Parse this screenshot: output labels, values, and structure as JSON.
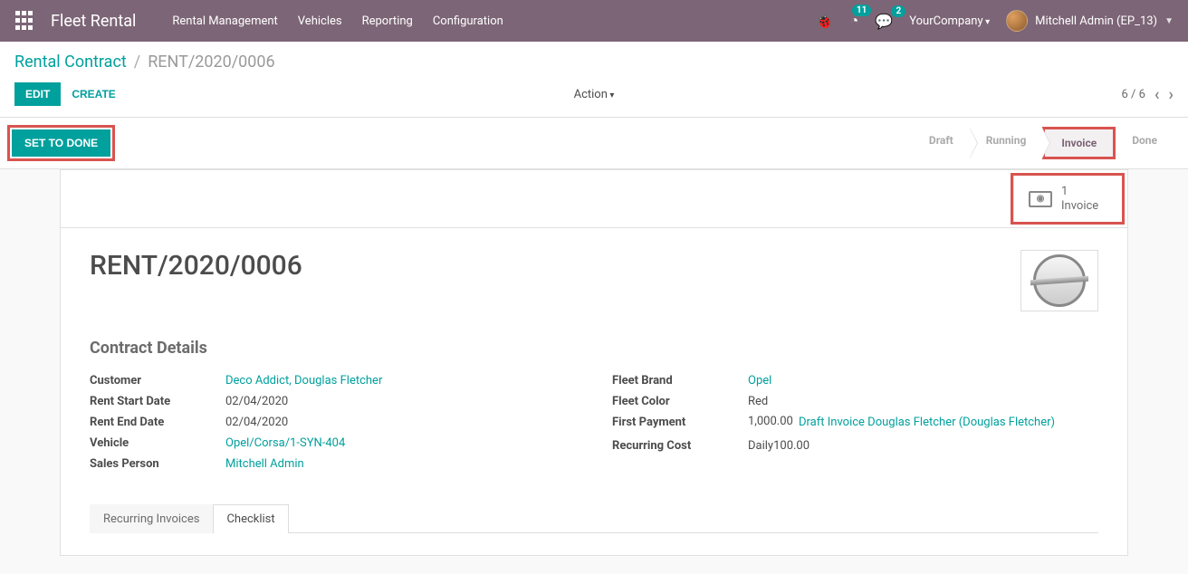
{
  "topbar": {
    "brand": "Fleet Rental",
    "menu": [
      "Rental Management",
      "Vehicles",
      "Reporting",
      "Configuration"
    ],
    "badges": {
      "activities": "11",
      "discuss": "2"
    },
    "company": "YourCompany",
    "user": "Mitchell Admin (EP_13)"
  },
  "breadcrumb": {
    "parent": "Rental Contract",
    "current": "RENT/2020/0006"
  },
  "controls": {
    "edit": "Edit",
    "create": "Create",
    "action": "Action",
    "pager": "6 / 6",
    "set_done": "Set to Done"
  },
  "status": {
    "steps": [
      "Draft",
      "Running",
      "Invoice",
      "Done"
    ],
    "active_index": 2
  },
  "stat_button": {
    "count": "1",
    "label": "Invoice"
  },
  "record": {
    "title": "RENT/2020/0006",
    "section": "Contract Details",
    "left": {
      "customer_l": "Customer",
      "customer_v": "Deco Addict, Douglas Fletcher",
      "start_l": "Rent Start Date",
      "start_v": "02/04/2020",
      "end_l": "Rent End Date",
      "end_v": "02/04/2020",
      "vehicle_l": "Vehicle",
      "vehicle_v": "Opel/Corsa/1-SYN-404",
      "sales_l": "Sales Person",
      "sales_v": "Mitchell Admin"
    },
    "right": {
      "brand_l": "Fleet Brand",
      "brand_v": "Opel",
      "color_l": "Fleet Color",
      "color_v": "Red",
      "firstpay_l": "First Payment",
      "firstpay_amt": "1,000.00",
      "firstpay_ref": "Draft Invoice Douglas Fletcher (Douglas Fletcher)",
      "recurring_l": "Recurring Cost",
      "recurring_period": "Daily",
      "recurring_amt": "100.00"
    }
  },
  "tabs": {
    "t1": "Recurring Invoices",
    "t2": "Checklist",
    "active": 1
  }
}
